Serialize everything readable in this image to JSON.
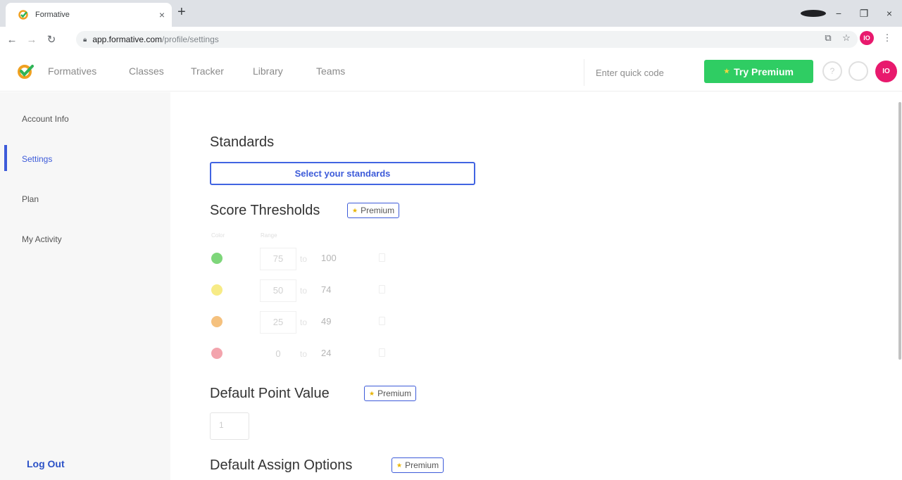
{
  "browser": {
    "tab_title": "Formative",
    "tab_close": "×",
    "new_tab": "+",
    "url_domain": "app.formative.com",
    "url_path": "/profile/settings",
    "profile_initials": "IO",
    "window_controls": {
      "minimize": "−",
      "maximize": "❐",
      "close": "×"
    }
  },
  "header": {
    "nav": [
      "Formatives",
      "Classes",
      "Tracker",
      "Library",
      "Teams"
    ],
    "quick_code_placeholder": "Enter quick code",
    "try_premium": "Try Premium",
    "help_icon": "?",
    "avatar_initials": "IO"
  },
  "sidebar": {
    "items": [
      "Account Info",
      "Settings",
      "Plan",
      "My Activity"
    ],
    "active": "Settings",
    "logout": "Log Out"
  },
  "main": {
    "standards": {
      "title": "Standards",
      "button": "Select your standards"
    },
    "score_thresholds": {
      "title": "Score Thresholds",
      "premium_label": "Premium",
      "col_color": "Color",
      "col_range": "Range",
      "to_word": "to",
      "rows": [
        {
          "from": "75",
          "to": "100",
          "color": "#7ed67a"
        },
        {
          "from": "50",
          "to": "74",
          "color": "#f7eb86"
        },
        {
          "from": "25",
          "to": "49",
          "color": "#f5c17e"
        },
        {
          "from": "0",
          "to": "24",
          "color": "#f3a4ad"
        }
      ]
    },
    "default_point_value": {
      "title": "Default Point Value",
      "premium_label": "Premium",
      "value": "1"
    },
    "default_assign_options": {
      "title": "Default Assign Options",
      "premium_label": "Premium"
    }
  },
  "colors": {
    "accent": "#3d5bd9",
    "premium_green": "#2fcd63",
    "avatar": "#e8196d"
  }
}
